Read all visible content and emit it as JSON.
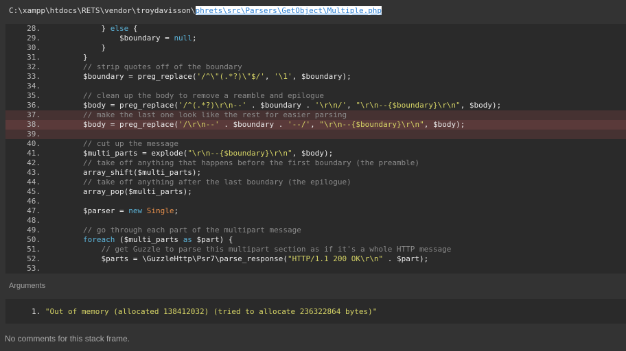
{
  "file_path": {
    "prefix": "C:\\xampp\\htdocs\\RETS\\vendor\\troydavisson\\",
    "link": "phrets\\src\\Parsers\\GetObject\\Multiple.php"
  },
  "code_lines": [
    {
      "n": "28.",
      "hl": "",
      "tokens": [
        [
          "pl",
          "            } "
        ],
        [
          "kw",
          "else"
        ],
        [
          "pl",
          " {"
        ]
      ]
    },
    {
      "n": "29.",
      "hl": "",
      "tokens": [
        [
          "pl",
          "                $boundary = "
        ],
        [
          "kw",
          "null"
        ],
        [
          "pl",
          ";"
        ]
      ]
    },
    {
      "n": "30.",
      "hl": "",
      "tokens": [
        [
          "pl",
          "            }"
        ]
      ]
    },
    {
      "n": "31.",
      "hl": "",
      "tokens": [
        [
          "pl",
          "        }"
        ]
      ]
    },
    {
      "n": "32.",
      "hl": "",
      "tokens": [
        [
          "com",
          "        // strip quotes off of the boundary"
        ]
      ]
    },
    {
      "n": "33.",
      "hl": "",
      "tokens": [
        [
          "pl",
          "        $boundary = preg_replace("
        ],
        [
          "str",
          "'/^\\\"(.*?)\\\"$/'"
        ],
        [
          "pl",
          ", "
        ],
        [
          "str",
          "'\\1'"
        ],
        [
          "pl",
          ", $boundary);"
        ]
      ]
    },
    {
      "n": "34.",
      "hl": "",
      "tokens": []
    },
    {
      "n": "35.",
      "hl": "",
      "tokens": [
        [
          "com",
          "        // clean up the body to remove a reamble and epilogue"
        ]
      ]
    },
    {
      "n": "36.",
      "hl": "",
      "tokens": [
        [
          "pl",
          "        $body = preg_replace("
        ],
        [
          "str",
          "'/^(.*?)\\r\\n--'"
        ],
        [
          "pl",
          " . $boundary . "
        ],
        [
          "str",
          "'\\r\\n/'"
        ],
        [
          "pl",
          ", "
        ],
        [
          "str",
          "\"\\r\\n--{$boundary}\\r\\n\""
        ],
        [
          "pl",
          ", $body);"
        ]
      ]
    },
    {
      "n": "37.",
      "hl": "soft",
      "tokens": [
        [
          "com",
          "        // make the last one look like the rest for easier parsing"
        ]
      ]
    },
    {
      "n": "38.",
      "hl": "strong",
      "tokens": [
        [
          "pl",
          "        $body = preg_replace("
        ],
        [
          "str",
          "'/\\r\\n--'"
        ],
        [
          "pl",
          " . $boundary . "
        ],
        [
          "str",
          "'--/'"
        ],
        [
          "pl",
          ", "
        ],
        [
          "str",
          "\"\\r\\n--{$boundary}\\r\\n\""
        ],
        [
          "pl",
          ", $body);"
        ]
      ]
    },
    {
      "n": "39.",
      "hl": "soft",
      "tokens": []
    },
    {
      "n": "40.",
      "hl": "",
      "tokens": [
        [
          "com",
          "        // cut up the message"
        ]
      ]
    },
    {
      "n": "41.",
      "hl": "",
      "tokens": [
        [
          "pl",
          "        $multi_parts = explode("
        ],
        [
          "str",
          "\"\\r\\n--{$boundary}\\r\\n\""
        ],
        [
          "pl",
          ", $body);"
        ]
      ]
    },
    {
      "n": "42.",
      "hl": "",
      "tokens": [
        [
          "com",
          "        // take off anything that happens before the first boundary (the preamble)"
        ]
      ]
    },
    {
      "n": "43.",
      "hl": "",
      "tokens": [
        [
          "pl",
          "        array_shift($multi_parts);"
        ]
      ]
    },
    {
      "n": "44.",
      "hl": "",
      "tokens": [
        [
          "com",
          "        // take off anything after the last boundary (the epilogue)"
        ]
      ]
    },
    {
      "n": "45.",
      "hl": "",
      "tokens": [
        [
          "pl",
          "        array_pop($multi_parts);"
        ]
      ]
    },
    {
      "n": "46.",
      "hl": "",
      "tokens": []
    },
    {
      "n": "47.",
      "hl": "",
      "tokens": [
        [
          "pl",
          "        $parser = "
        ],
        [
          "kw",
          "new"
        ],
        [
          "pl",
          " "
        ],
        [
          "cls",
          "Single"
        ],
        [
          "pl",
          ";"
        ]
      ]
    },
    {
      "n": "48.",
      "hl": "",
      "tokens": []
    },
    {
      "n": "49.",
      "hl": "",
      "tokens": [
        [
          "com",
          "        // go through each part of the multipart message"
        ]
      ]
    },
    {
      "n": "50.",
      "hl": "",
      "tokens": [
        [
          "kw",
          "        foreach"
        ],
        [
          "pl",
          " ($multi_parts "
        ],
        [
          "kw",
          "as"
        ],
        [
          "pl",
          " $part) {"
        ]
      ]
    },
    {
      "n": "51.",
      "hl": "",
      "tokens": [
        [
          "com",
          "            // get Guzzle to parse this multipart section as if it's a whole HTTP message"
        ]
      ]
    },
    {
      "n": "52.",
      "hl": "",
      "tokens": [
        [
          "pl",
          "            $parts = \\GuzzleHttp\\Psr7\\parse_response("
        ],
        [
          "str",
          "\"HTTP/1.1 200 OK\\r\\n\""
        ],
        [
          "pl",
          " . $part);"
        ]
      ]
    },
    {
      "n": "53.",
      "hl": "",
      "tokens": []
    }
  ],
  "arguments": {
    "title": "Arguments",
    "items": [
      {
        "num": "1.",
        "value": "\"Out of memory (allocated 138412032) (tried to allocate 236322864 bytes)\""
      }
    ]
  },
  "comments_text": "No comments for this stack frame.",
  "colors": {
    "background": "#333333",
    "panel": "#2a2a2a",
    "highlight_line": "#5a3a3a",
    "context_line": "#463232",
    "keyword": "#5cb3d8",
    "string": "#d6d466",
    "comment": "#8a8a8a",
    "class": "#e8904c"
  }
}
